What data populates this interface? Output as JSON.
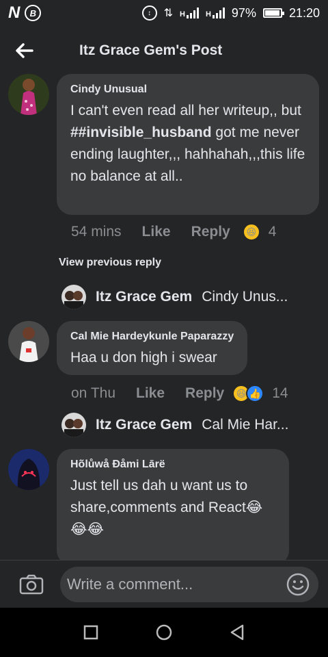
{
  "status_bar": {
    "carrier_logo": "N",
    "b_icon": "B",
    "network_small": "H",
    "battery_percent": "97%",
    "battery_level": 0.97,
    "time": "21:20"
  },
  "header": {
    "title": "Itz Grace Gem's Post"
  },
  "comments": [
    {
      "author": "Cindy Unusual",
      "text_before": "I can't even read all her writeup,, but ",
      "text_bold": "##invisible_husband",
      "text_after": " got me never ending laughter,,, hahhahah,,,this life no balance at all..",
      "time": "54 mins",
      "like_label": "Like",
      "reply_label": "Reply",
      "reaction_count": "4"
    },
    {
      "author": "Cal Mie Hardeykunle Paparazzy",
      "text": "Haa u don high i swear",
      "time": "on Thu",
      "like_label": "Like",
      "reply_label": "Reply",
      "reaction_count": "14"
    },
    {
      "author": "Hõlůwå Đåmi Lārë",
      "text": "Just tell us dah u want us to share,comments and React",
      "emojis": "😂😂😂"
    }
  ],
  "view_previous": "View previous reply",
  "replies": [
    {
      "author": "Itz Grace Gem",
      "snippet": "Cindy Unus..."
    },
    {
      "author": "Itz Grace Gem",
      "snippet": "Cal Mie Har..."
    }
  ],
  "composer": {
    "placeholder": "Write a comment..."
  },
  "colors": {
    "background": "#242526",
    "bubble": "#3a3b3c",
    "text": "#e4e6eb",
    "muted": "#8a8d91",
    "like_blue": "#2d88ff",
    "emoji_yellow": "#f7c01e"
  }
}
